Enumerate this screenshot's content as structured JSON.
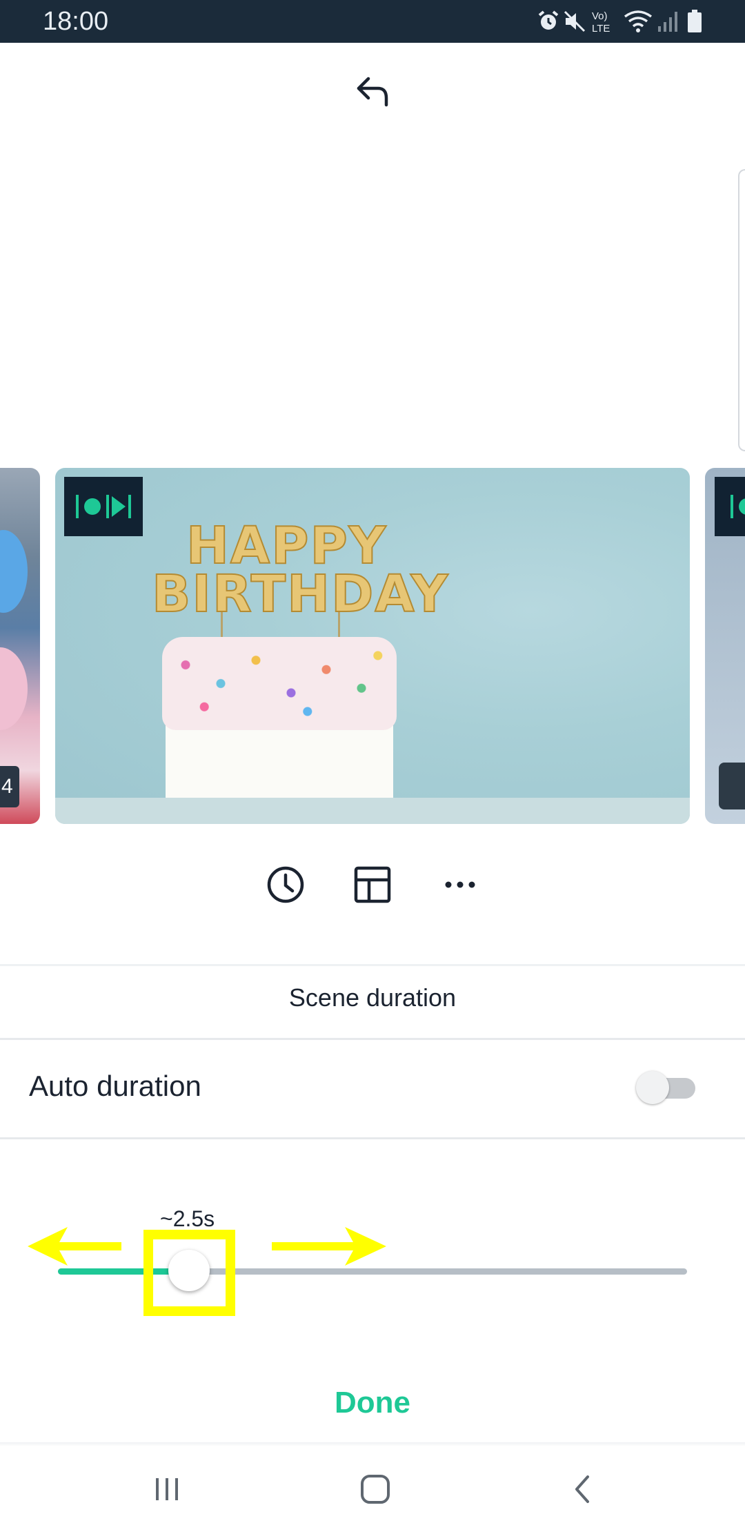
{
  "status_bar": {
    "time": "18:00",
    "icons": [
      "alarm-icon",
      "mute-icon",
      "volte-icon",
      "wifi-icon",
      "signal-icon",
      "battery-icon"
    ]
  },
  "toolbar": {
    "undo_icon": "undo-icon"
  },
  "scenes": {
    "left_badge": "4",
    "main_text": {
      "line1": "HAPPY",
      "line2": "BIRTHDAY"
    },
    "badge_icon": "video-clip-icon"
  },
  "actions": [
    "clock-icon",
    "layout-icon",
    "more-icon"
  ],
  "panel": {
    "title": "Scene duration",
    "auto_duration_label": "Auto duration",
    "auto_duration_enabled": false,
    "slider_value_label": "~2.5s",
    "slider_fraction": 0.208,
    "done_label": "Done"
  },
  "colors": {
    "accent": "#1ec896",
    "status_bar": "#1b2b3a",
    "highlight": "#ffff00"
  },
  "nav_bar": [
    "recents-icon",
    "home-icon",
    "back-icon"
  ]
}
